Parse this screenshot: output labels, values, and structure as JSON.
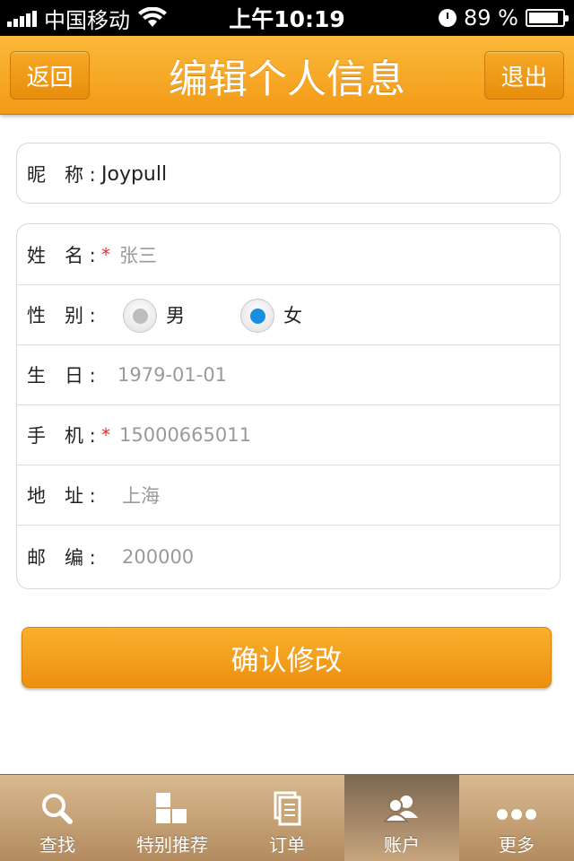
{
  "status_bar": {
    "carrier": "中国移动",
    "time": "上午10:19",
    "battery": "89 %",
    "battery_level": 0.89
  },
  "nav": {
    "back_label": "返回",
    "title": "编辑个人信息",
    "logout_label": "退出"
  },
  "nickname": {
    "label": "昵　称 :",
    "value": "Joypull"
  },
  "form": {
    "name": {
      "label": "姓　名 :",
      "required": "*",
      "value": "张三"
    },
    "gender": {
      "label": "性　别 :",
      "options": [
        {
          "label": "男",
          "selected": false
        },
        {
          "label": "女",
          "selected": true
        }
      ],
      "selected_color": "#1a8fe0"
    },
    "birthday": {
      "label": "生　日 :",
      "value": "1979-01-01"
    },
    "phone": {
      "label": "手　机 :",
      "required": "*",
      "value": "15000665011"
    },
    "address": {
      "label": "地　址 :",
      "value": "上海"
    },
    "zip": {
      "label": "邮　编 :",
      "value": "200000"
    }
  },
  "confirm_label": "确认修改",
  "tabs": [
    {
      "label": "查找",
      "icon": "search-icon",
      "active": false
    },
    {
      "label": "特别推荐",
      "icon": "grid-icon",
      "active": false
    },
    {
      "label": "订单",
      "icon": "document-icon",
      "active": false
    },
    {
      "label": "账户",
      "icon": "users-icon",
      "active": true
    },
    {
      "label": "更多",
      "icon": "more-icon",
      "active": false
    }
  ],
  "colors": {
    "accent": "#f29a16",
    "required": "#e53030",
    "tabbar": "#b38b5f"
  }
}
